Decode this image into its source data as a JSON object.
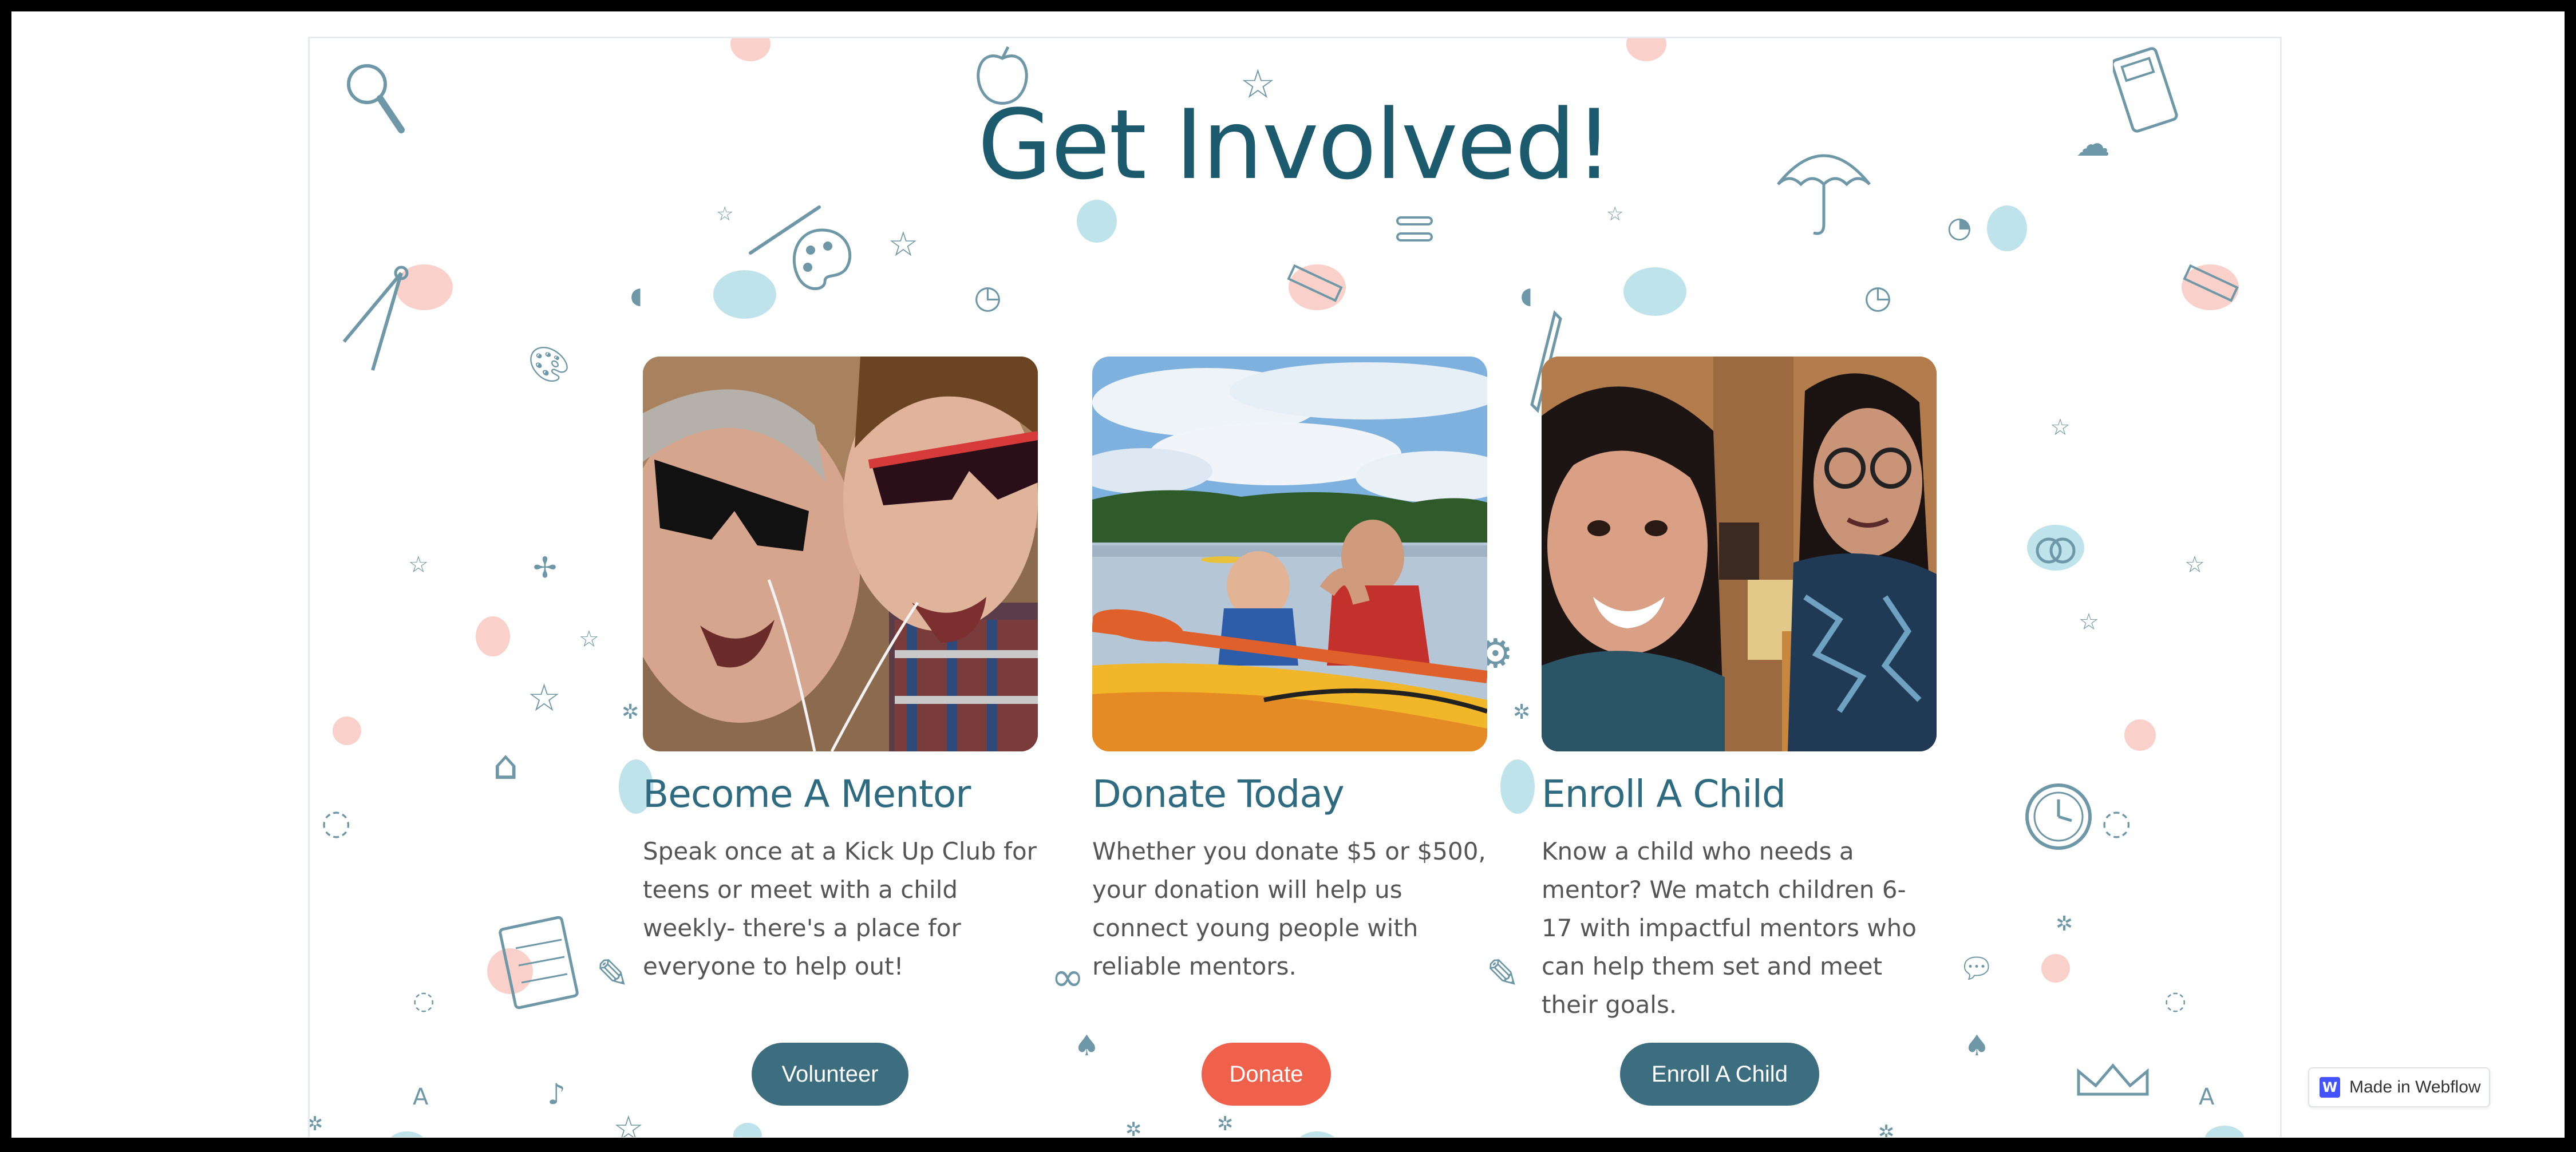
{
  "page": {
    "title": "Get Involved!",
    "colors": {
      "heading": "#1c5a6e",
      "card_title": "#2e6b80",
      "body_text": "#555555",
      "button_teal": "#3d6e80",
      "button_coral": "#f0614c",
      "doodle": "#6e98a7",
      "blob_blue": "#a9d9e3",
      "blob_pink": "#f6bdb3"
    }
  },
  "cards": [
    {
      "title": "Become A Mentor",
      "description": "Speak once at a Kick Up Club for teens or meet with a child weekly- there's a place for everyone to help out!",
      "button_label": "Volunteer",
      "photo": "mentor-and-teen-wearing-sunglasses"
    },
    {
      "title": "Donate Today",
      "description": "Whether you donate $5 or $500, your donation will help us connect young people with reliable mentors.",
      "button_label": "Donate",
      "photo": "boy-and-man-kayaking-on-lake"
    },
    {
      "title": "Enroll A Child",
      "description": "Know a child who needs a mentor? We match children 6-17 with impactful mentors who can help them set and meet their goals.",
      "button_label": "Enroll A Child",
      "photo": "woman-and-girl-selfie"
    }
  ],
  "badge": {
    "logo_letter": "W",
    "label": "Made in Webflow"
  },
  "icons": [
    "magnifier-icon",
    "apple-icon",
    "star-icon",
    "umbrella-icon",
    "calculator-icon",
    "cloud-icon",
    "palette-icon",
    "compass-icon",
    "ruler-icon",
    "clock-icon",
    "notebook-icon",
    "pencil-icon",
    "crown-icon",
    "music-note-icon",
    "paperclip-icon",
    "leaf-icon",
    "house-icon",
    "speech-bubble-icon"
  ]
}
